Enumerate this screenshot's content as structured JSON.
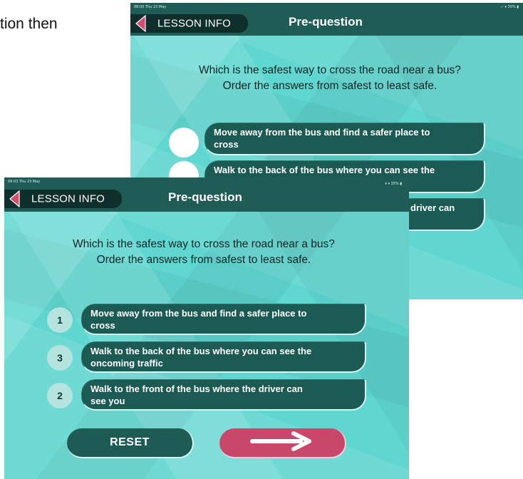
{
  "document": {
    "text_fragment": "tion then"
  },
  "screen_back": {
    "status_time": "08:00  Thu 23 May",
    "status_battery": "✓ ▾ 35% ▮",
    "lesson_button_label": "LESSON INFO",
    "title": "Pre-question",
    "prompt_line1": "Which is the safest way to cross the road near a bus?",
    "prompt_line2": "Order the answers from safest to least safe.",
    "answers": [
      {
        "line1": "Move away from the bus and find a safer place to",
        "line2": "cross",
        "number": ""
      },
      {
        "line1": "Walk to the back of the bus where you can see the",
        "line2": "",
        "number": ""
      },
      {
        "line1": "driver can",
        "line2": "",
        "number": ""
      }
    ]
  },
  "screen_front": {
    "status_time": "09:03  Thu 23 May",
    "status_battery": "▾ ▾ 35% ▮",
    "lesson_button_label": "LESSON INFO",
    "title": "Pre-question",
    "prompt_line1": "Which is the safest way to cross the road near a bus?",
    "prompt_line2": "Order the answers from safest to least safe.",
    "answers": [
      {
        "number": "1",
        "line1": "Move away from the bus and find a safer place to",
        "line2": "cross"
      },
      {
        "number": "3",
        "line1": "Walk to the back of the bus where you can see the",
        "line2": "oncoming traffic"
      },
      {
        "number": "2",
        "line1": "Walk to the front of the bus where the driver can",
        "line2": "see you"
      }
    ],
    "reset_label": "RESET",
    "next_icon": "arrow-right-icon"
  },
  "colors": {
    "teal_background": "#5fd6cf",
    "nav_bar": "#1f5c55",
    "pill": "#1c5a54",
    "next_button": "#c8476a",
    "back_arrow": "#d64b6c"
  }
}
